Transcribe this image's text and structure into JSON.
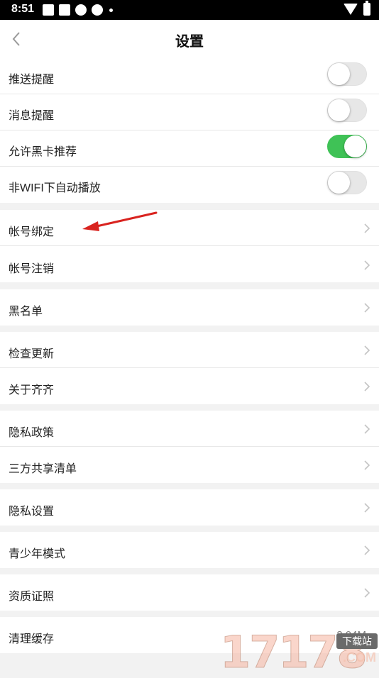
{
  "status_bar": {
    "time": "8:51",
    "icons": [
      "sim-card-icon",
      "mail-icon",
      "app-icon",
      "app-icon",
      "notification-dot-icon",
      "wifi-icon",
      "battery-icon"
    ]
  },
  "header": {
    "title": "设置",
    "back_icon": "chevron-left-icon"
  },
  "toggles": [
    {
      "label": "推送提醒",
      "on": false
    },
    {
      "label": "消息提醒",
      "on": false
    },
    {
      "label": "允许黑卡推荐",
      "on": true
    },
    {
      "label": "非WIFI下自动播放",
      "on": false
    }
  ],
  "menu_items": [
    {
      "label": "帐号绑定"
    },
    {
      "label": "帐号注销"
    },
    {
      "label": "黑名单"
    },
    {
      "label": "检查更新"
    },
    {
      "label": "关于齐齐"
    },
    {
      "label": "隐私政策"
    },
    {
      "label": "三方共享清单"
    },
    {
      "label": "隐私设置"
    },
    {
      "label": "青少年模式"
    },
    {
      "label": "资质证照"
    }
  ],
  "cache": {
    "label": "清理缓存",
    "size": "2.04M"
  },
  "watermark": {
    "digits": "17178",
    "badge": "下载站",
    "domain": ".COM"
  },
  "colors": {
    "toggle_on": "#3fc256",
    "toggle_off": "#e7e7e7",
    "annotation_arrow": "#d9231f"
  }
}
